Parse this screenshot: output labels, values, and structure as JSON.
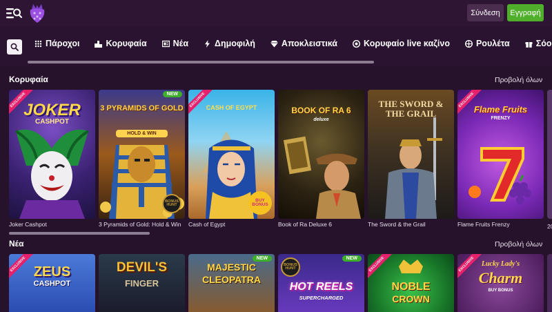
{
  "header": {
    "login_label": "Σύνδεση",
    "register_label": "Εγγραφή",
    "colors": {
      "bar": "#2e1533",
      "register": "#4fae2a",
      "login": "#4a2d4f"
    }
  },
  "categories": [
    {
      "label": "Πάροχοι",
      "icon": "grid-icon"
    },
    {
      "label": "Κορυφαία",
      "icon": "podium-icon"
    },
    {
      "label": "Νέα",
      "icon": "new-icon"
    },
    {
      "label": "Δημοφιλή",
      "icon": "bolt-icon"
    },
    {
      "label": "Αποκλειστικά",
      "icon": "diamond-icon"
    },
    {
      "label": "Κορυφαίο live καζίνο",
      "icon": "chip-icon"
    },
    {
      "label": "Ρουλέτα",
      "icon": "roulette-icon"
    },
    {
      "label": "Σόου παιχ",
      "icon": "gift-icon"
    }
  ],
  "sections": [
    {
      "title": "Κορυφαία",
      "view_all": "Προβολή όλων",
      "games": [
        {
          "name": "Joker Cashpot",
          "art": "JOKER",
          "art_sub": "CASHPOT",
          "badge": "EXCLUSIVE"
        },
        {
          "name": "3 Pyramids of Gold: Hold & Win",
          "art": "3 PYRAMIDS OF GOLD",
          "art_sub": "HOLD & WIN",
          "badge": "NEW",
          "extra": "BONUS HUNT"
        },
        {
          "name": "Cash of Egypt",
          "art": "CASH OF EGYPT",
          "art_sub": "",
          "badge": "EXCLUSIVE",
          "extra": "BUY BONUS"
        },
        {
          "name": "Book of Ra Deluxe 6",
          "art": "BOOK OF RA 6",
          "art_sub": "deluxe",
          "badge": ""
        },
        {
          "name": "The Sword & the Grail",
          "art": "THE SWORD & THE GRAIL",
          "art_sub": "",
          "badge": ""
        },
        {
          "name": "Flame Fruits Frenzy",
          "art": "Flame Fruits",
          "art_sub": "FRENZY",
          "badge": "EXCLUSIVE"
        }
      ],
      "partial_caption": "20"
    },
    {
      "title": "Νέα",
      "view_all": "Προβολή όλων",
      "games": [
        {
          "art": "ZEUS",
          "art_sub": "CASHPOT",
          "badge": "EXCLUSIVE"
        },
        {
          "art": "DEVIL'S",
          "art_sub": "FINGER",
          "badge": ""
        },
        {
          "art": "MAJESTIC",
          "art_sub": "CLEOPATRA",
          "badge": "NEW"
        },
        {
          "art": "HOT REELS",
          "art_sub": "SUPERCHARGED",
          "badge": "NEW",
          "extra": "BONUS HUNT"
        },
        {
          "art": "NOBLE",
          "art_sub": "CROWN",
          "badge": "EXCLUSIVE"
        },
        {
          "art": "Lucky Lady's",
          "art_sub": "Charm",
          "art_sub2": "BUY BONUS",
          "badge": "EXCLUSIVE"
        }
      ]
    }
  ]
}
